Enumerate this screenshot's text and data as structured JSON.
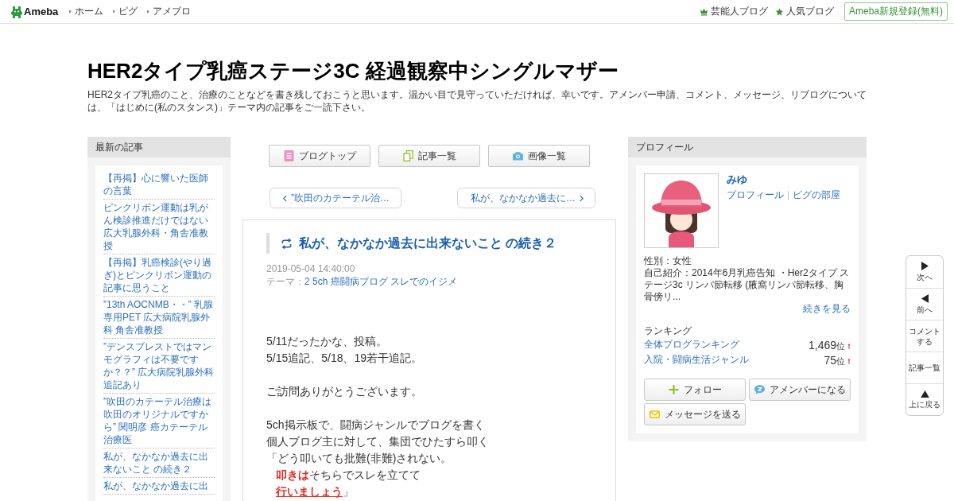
{
  "topbar": {
    "logo": "Ameba",
    "nav": [
      {
        "label": "ホーム"
      },
      {
        "label": "ピグ"
      },
      {
        "label": "アメブロ"
      }
    ],
    "links": [
      {
        "label": "芸能人ブログ",
        "kind": "crown"
      },
      {
        "label": "人気ブログ",
        "kind": "star"
      }
    ],
    "signup": "Ameba新規登録(無料)"
  },
  "header": {
    "title": "HER2タイプ乳癌ステージ3C 経過観察中シングルマザー",
    "description": "HER2タイプ乳癌のこと、治療のことなどを書き残しておこうと思います。温かい目で見守っていただければ、幸いです。アメンバー申請、コメント、メッセージ、リブログについては、「はじめに(私のスタンス)」テーマ内の記事をご一読下さい。"
  },
  "sidebar": {
    "title": "最新の記事",
    "items": [
      "【再掲】心に響いた医師の言葉",
      "ピンクリボン運動は乳がん検診推進だけではない広大乳腺外科・角舎准教授",
      "【再掲】乳癌検診(やり過ぎ)とピンクリボン運動の記事に思うこと",
      "”13th AOCNMB・・” 乳腺専用PET 広大病院乳腺外科 角舎准教授",
      "”デンスブレストではマンモグラフィは不要ですか？？” 広大病院乳腺外科追記あり",
      "”吹田のカテーテル治療は吹田のオリジナルですから” 関明彦 癌カテーテル治療医",
      "私が、なかなか過去に出来ないこと の続き２",
      "私が、なかなか過去に出"
    ]
  },
  "toolbar": [
    {
      "label": "ブログトップ",
      "kind": "top"
    },
    {
      "label": "記事一覧",
      "kind": "list"
    },
    {
      "label": "画像一覧",
      "kind": "images"
    }
  ],
  "pager": {
    "prev": "”吹田のカテーテル治…",
    "next": "私が、なかなか過去に…"
  },
  "article": {
    "title": "私が、なかなか過去に出来ないこと の続き２",
    "date": "2019-05-04 14:40:00",
    "theme_label": "テーマ：",
    "theme": "2 5ch 癌闘病ブログ スレでのイジメ",
    "paragraphs": [
      {
        "lines": [
          {
            "indented": false,
            "runs": [
              {
                "text": "5/11だったかな、投稿。",
                "kind": "plain"
              }
            ]
          },
          {
            "indented": false,
            "runs": [
              {
                "text": "5/15追記、5/18、19若干追記。",
                "kind": "plain"
              }
            ]
          }
        ]
      },
      {
        "lines": [
          {
            "indented": false,
            "runs": [
              {
                "text": "ご訪問ありがとうございます。",
                "kind": "plain"
              }
            ]
          }
        ]
      },
      {
        "lines": [
          {
            "indented": false,
            "runs": [
              {
                "text": "5ch掲示板で、闘病ジャンルでブログを書く",
                "kind": "plain"
              }
            ]
          },
          {
            "indented": false,
            "runs": [
              {
                "text": "個人ブログ主に対して、集団でひたすら叩く",
                "kind": "plain"
              }
            ]
          },
          {
            "indented": false,
            "runs": [
              {
                "text": "「どう叩いても批難(非難)されない。",
                "kind": "plain"
              }
            ]
          },
          {
            "indented": true,
            "runs": [
              {
                "text": "叩きは",
                "kind": "emphasis"
              },
              {
                "text": "そちらでスレを立てて",
                "kind": "plain"
              }
            ]
          },
          {
            "indented": true,
            "runs": [
              {
                "text": "行いましょう",
                "kind": "emphasis-underline"
              },
              {
                "text": "」",
                "kind": "plain"
              }
            ]
          }
        ]
      }
    ]
  },
  "profile": {
    "title": "プロフィール",
    "name": "みゆ",
    "links": [
      {
        "label": "プロフィール"
      },
      {
        "label": "ピグの部屋"
      }
    ],
    "gender": "性別：女性",
    "intro": "自己紹介：2014年6月乳癌告知 ・Her2タイプ ステージ3c リンパ節転移 (腋窩リンパ節転移、胸骨傍リ...",
    "more": "続きを見る",
    "ranking_title": "ランキング",
    "rankings": [
      {
        "label": "全体ブログランキング",
        "rank": "1,469",
        "unit": "位",
        "kind": "up"
      },
      {
        "label": "入院・闘病生活ジャンル",
        "rank": "75",
        "unit": "位",
        "kind": "up"
      }
    ],
    "buttons": [
      {
        "label": "フォロー",
        "kind": "follow"
      },
      {
        "label": "アメンバーになる",
        "kind": "amember"
      },
      {
        "label": "メッセージを送る",
        "kind": "message"
      }
    ]
  },
  "side_nav": [
    {
      "label": "次へ",
      "kind": "next"
    },
    {
      "label": "前へ",
      "kind": "prev"
    },
    {
      "label": "コメントする",
      "kind": "comment"
    },
    {
      "label": "記事一覧",
      "kind": "list"
    },
    {
      "label": "上に戻る",
      "kind": "top"
    }
  ]
}
